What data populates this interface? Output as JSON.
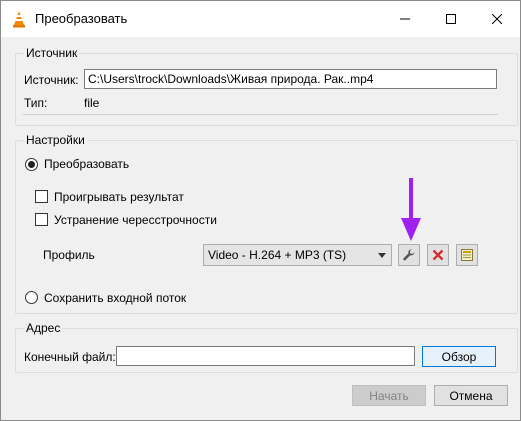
{
  "window": {
    "title": "Преобразовать"
  },
  "source": {
    "group_title": "Источник",
    "source_label": "Источник:",
    "source_value": "C:\\Users\\trock\\Downloads\\Живая природа. Рак..mp4",
    "type_label": "Тип:",
    "type_value": "file"
  },
  "settings": {
    "group_title": "Настройки",
    "convert_label": "Преобразовать",
    "convert_selected": true,
    "play_result_label": "Проигрывать результат",
    "play_result_checked": false,
    "deinterlace_label": "Устранение чересстрочности",
    "deinterlace_checked": false,
    "profile_label": "Профиль",
    "profile_value": "Video - H.264 + MP3 (TS)",
    "save_raw_label": "Сохранить входной поток",
    "save_raw_selected": false
  },
  "address": {
    "group_title": "Адрес",
    "dest_label": "Конечный файл:",
    "dest_value": "",
    "browse_label": "Обзор"
  },
  "footer": {
    "start_label": "Начать",
    "cancel_label": "Отмена"
  },
  "colors": {
    "annotation_arrow": "#a020f0",
    "delete_icon": "#d32f2f",
    "vlc_orange": "#f08a00"
  },
  "icons": [
    "vlc-cone-icon",
    "minimize-icon",
    "maximize-icon",
    "close-icon",
    "wrench-icon",
    "delete-x-icon",
    "new-profile-icon",
    "annotation-arrow-icon"
  ]
}
